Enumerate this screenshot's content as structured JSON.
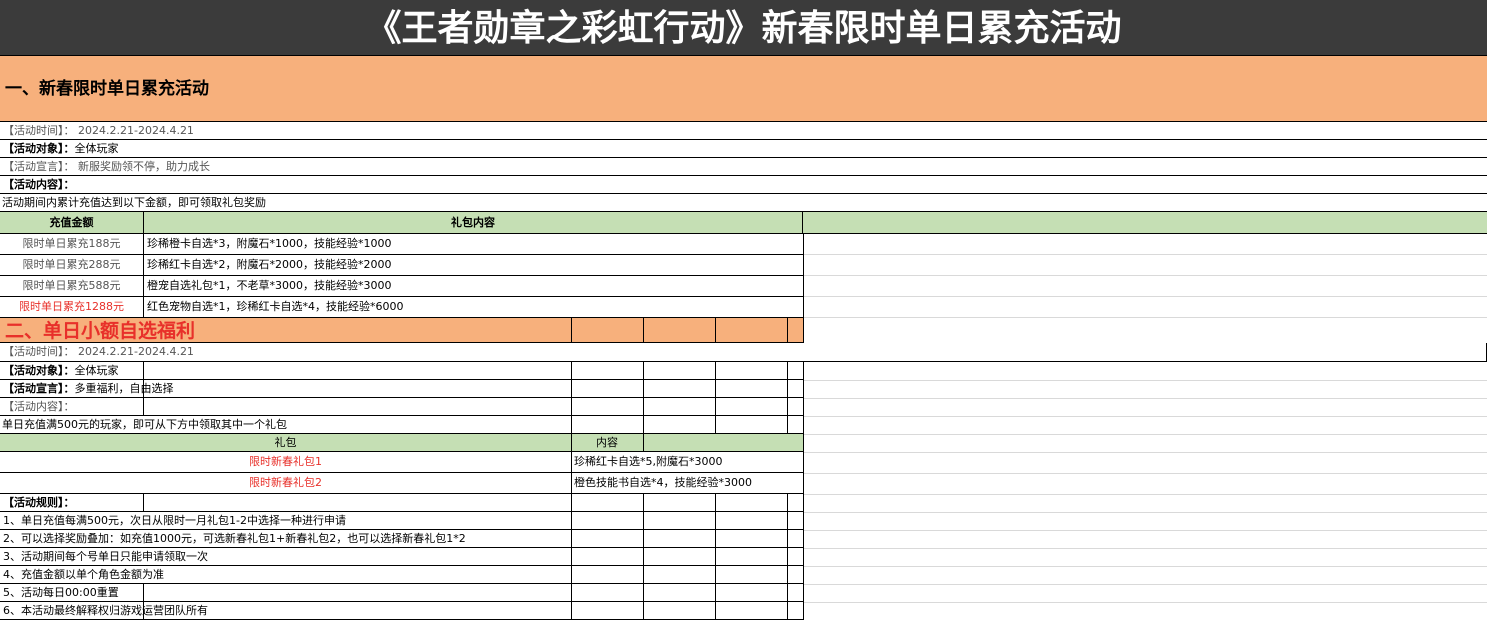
{
  "title": "《王者勋章之彩虹行动》新春限时单日累充活动",
  "colors": {
    "title_bg": "#3b3b3b",
    "section_bg": "#f7b07c",
    "header_bg": "#c5dfb4",
    "accent_red": "#e8302a"
  },
  "section1": {
    "heading": "一、新春限时单日累充活动",
    "time_label": "【活动时间】：",
    "time_value": "2024.2.21-2024.4.21",
    "target_label": "【活动对象】：",
    "target_value": "全体玩家",
    "slogan_label": "【活动宣言】：",
    "slogan_value": "新服奖励领不停，助力成长",
    "content_label": "【活动内容】：",
    "description": "活动期间内累计充值达到以下金额，即可领取礼包奖励",
    "col_amount": "充值金额",
    "col_gift": "礼包内容",
    "rows": [
      {
        "amount": "限时单日累充188元",
        "gift": "珍稀橙卡自选*3，附魔石*1000，技能经验*1000"
      },
      {
        "amount": "限时单日累充288元",
        "gift": "珍稀红卡自选*2，附魔石*2000，技能经验*2000"
      },
      {
        "amount": "限时单日累充588元",
        "gift": "橙宠自选礼包*1，不老草*3000，技能经验*3000"
      },
      {
        "amount": "限时单日累充1288元",
        "gift": "红色宠物自选*1，珍稀红卡自选*4，技能经验*6000"
      }
    ]
  },
  "section2": {
    "heading": "二、单日小额自选福利",
    "time_label": "【活动时间】：",
    "time_value": "2024.2.21-2024.4.21",
    "target_label": "【活动对象】：",
    "target_value": "全体玩家",
    "slogan_label": "【活动宣言】：",
    "slogan_value": "多重福利，自由选择",
    "content_label": "【活动内容】：",
    "description": "单日充值满500元的玩家，即可从下方中领取其中一个礼包",
    "col_pack": "礼包",
    "col_content": "内容",
    "rows": [
      {
        "pack": "限时新春礼包1",
        "content": "珍稀红卡自选*5,附魔石*3000"
      },
      {
        "pack": "限时新春礼包2",
        "content": "橙色技能书自选*4，技能经验*3000"
      }
    ],
    "rules_label": "【活动规则】：",
    "rules": [
      "1、单日充值每满500元，次日从限时一月礼包1-2中选择一种进行申请",
      "2、可以选择奖励叠加：如充值1000元，可选新春礼包1+新春礼包2，也可以选择新春礼包1*2",
      "3、活动期间每个号单日只能申请领取一次",
      "4、充值金额以单个角色金额为准",
      "5、活动每日00:00重置",
      "6、本活动最终解释权归游戏运营团队所有"
    ]
  }
}
